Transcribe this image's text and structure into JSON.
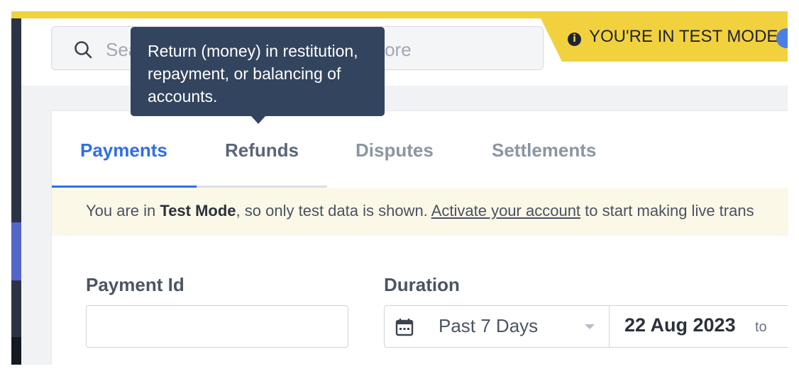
{
  "search": {
    "placeholder": "Search payments, settings, and more"
  },
  "test_mode_banner": {
    "text": "YOU'RE IN TEST MODE",
    "background_color": "#f2d13f",
    "toggle_color": "#4c7ee4",
    "icon": "info-icon"
  },
  "tooltip": {
    "text": "Return (money) in restitution, repayment, or balancing of accounts."
  },
  "tabs": [
    {
      "label": "Payments",
      "active": true
    },
    {
      "label": "Refunds",
      "active": false
    },
    {
      "label": "Disputes",
      "active": false
    },
    {
      "label": "Settlements",
      "active": false
    }
  ],
  "notice": {
    "prefix": "You are in ",
    "bold": "Test Mode",
    "middle": ", so only test data is shown. ",
    "link": "Activate your account",
    "suffix": " to start making live trans"
  },
  "filters": {
    "payment_id_label": "Payment Id",
    "payment_id_value": "",
    "duration_label": "Duration",
    "duration_selected": "Past 7 Days",
    "start_date": "22 Aug 2023",
    "to_label": "to"
  },
  "colors": {
    "accent": "#2f6ee6",
    "sidebar": "#2c3345",
    "tooltip_bg": "#33445e"
  }
}
